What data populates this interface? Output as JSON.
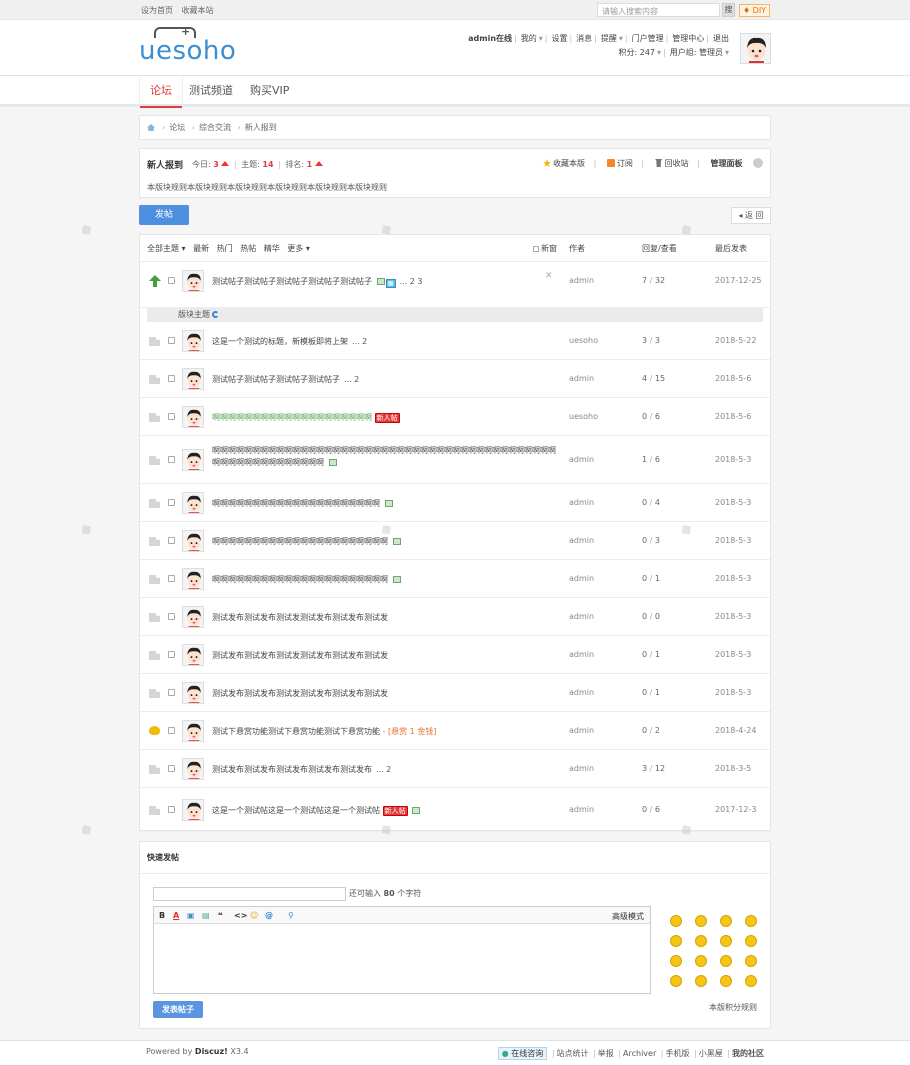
{
  "topbar": {
    "set_home": "设为首页",
    "bookmark": "收藏本站",
    "search_placeholder": "请输入搜索内容",
    "search_btn": "搜",
    "diy": "♦ DIY"
  },
  "header": {
    "logo": "uesoho",
    "user_links": [
      "admin在线",
      "我的",
      "设置",
      "消息",
      "提醒",
      "门户管理",
      "管理中心",
      "退出"
    ],
    "credits": "积分: 247",
    "group": "用户组: 管理员"
  },
  "nav": {
    "items": [
      "论坛",
      "测试频道",
      "购买VIP"
    ]
  },
  "breadcrumb": [
    "论坛",
    "综合交流",
    "新人报到"
  ],
  "forum": {
    "title": "新人报到",
    "today_label": "今日:",
    "today": "3",
    "topics_label": "主题:",
    "topics": "14",
    "rank_label": "排名:",
    "rank": "1",
    "tools": [
      "收藏本版",
      "订阅",
      "回收站",
      "管理面板"
    ],
    "rules": "本版块规则本版块规则本版块规则本版块规则本版块规则本版块规则"
  },
  "buttons": {
    "post": "发帖",
    "back": "◂ 返 回"
  },
  "list_header": {
    "filters": [
      "全部主题",
      "最新",
      "热门",
      "热帖",
      "精华",
      "更多"
    ],
    "new_window": "新窗",
    "author": "作者",
    "replies": "回复/查看",
    "last_post": "最后发表"
  },
  "sticky_sep": "版块主题",
  "threads": [
    {
      "title": "测试帖子测试帖子测试帖子测试帖子测试帖子",
      "pages": "... 2  3",
      "author": "admin",
      "replies": "7",
      "views": "32",
      "date": "2017-12-25"
    },
    {
      "title": "这是一个测试的标题，新模板即将上架",
      "pages": "... 2",
      "author": "uesoho",
      "replies": "3",
      "views": "3",
      "date": "2018-5-22"
    },
    {
      "title": "测试帖子测试帖子测试帖子测试帖子",
      "pages": "... 2",
      "author": "admin",
      "replies": "4",
      "views": "15",
      "date": "2018-5-6"
    },
    {
      "title": "啊啊啊啊啊啊啊啊啊啊啊啊啊啊啊啊啊啊啊啊",
      "pages": "",
      "tag": "新人帖",
      "author": "uesoho",
      "replies": "0",
      "views": "6",
      "date": "2018-5-6"
    },
    {
      "title": "啊啊啊啊啊啊啊啊啊啊啊啊啊啊啊啊啊啊啊啊啊啊啊啊啊啊啊啊啊啊啊啊啊啊啊啊啊啊啊啊啊啊啊啊啊啊啊啊啊啊啊啊啊啊啊啊",
      "title2": "啊",
      "pages": "",
      "author": "admin",
      "replies": "1",
      "views": "6",
      "date": "2018-5-3"
    },
    {
      "title": "啊啊啊啊啊啊啊啊啊啊啊啊啊啊啊啊啊啊啊啊啊",
      "pages": "",
      "author": "admin",
      "replies": "0",
      "views": "4",
      "date": "2018-5-3"
    },
    {
      "title": "啊啊啊啊啊啊啊啊啊啊啊啊啊啊啊啊啊啊啊啊啊啊",
      "pages": "",
      "author": "admin",
      "replies": "0",
      "views": "3",
      "date": "2018-5-3"
    },
    {
      "title": "啊啊啊啊啊啊啊啊啊啊啊啊啊啊啊啊啊啊啊啊啊啊",
      "pages": "",
      "author": "admin",
      "replies": "0",
      "views": "1",
      "date": "2018-5-3"
    },
    {
      "title": "测试发布测试发布测试发测试发布测试发布测试发",
      "pages": "",
      "author": "admin",
      "replies": "0",
      "views": "0",
      "date": "2018-5-3"
    },
    {
      "title": "测试发布测试发布测试发测试发布测试发布测试发",
      "pages": "",
      "author": "admin",
      "replies": "0",
      "views": "1",
      "date": "2018-5-3"
    },
    {
      "title": "测试发布测试发布测试发测试发布测试发布测试发",
      "pages": "",
      "author": "admin",
      "replies": "0",
      "views": "1",
      "date": "2018-5-3"
    },
    {
      "title": "测试下悬赏功能测试下悬赏功能测试下悬赏功能",
      "reward": " - [悬赏 1 金钱]",
      "pages": "",
      "author": "admin",
      "replies": "0",
      "views": "2",
      "date": "2018-4-24"
    },
    {
      "title": "测试发布测试发布测试发布测试发布测试发布",
      "pages": "... 2",
      "author": "admin",
      "replies": "3",
      "views": "12",
      "date": "2018-3-5"
    },
    {
      "title": "这是一个测试帖这是一个测试帖这是一个测试帖",
      "pages": "",
      "tag": "新人帖",
      "author": "admin",
      "replies": "0",
      "views": "6",
      "date": "2017-12-3"
    }
  ],
  "quick_post": {
    "title": "快速发帖",
    "remain_pre": "还可输入",
    "remain_num": "80",
    "remain_post": "个字符",
    "advanced": "高级模式",
    "toolbar": [
      "B",
      "A",
      "▣",
      "▤",
      "❝",
      "<>",
      "☺",
      "@",
      "⚲"
    ],
    "submit": "发表帖子",
    "rule": "本版积分规则"
  },
  "footer": {
    "powered": "Powered by",
    "brand": "Discuz!",
    "version": "X3.4",
    "online": "在线咨询",
    "links": [
      "站点统计",
      "举报",
      "Archiver",
      "手机版",
      "小黑屋",
      "我的社区"
    ]
  },
  "colors": {
    "accent": "#e13d3d",
    "blue": "#4e8fe0",
    "logo": "#3d8fd3"
  }
}
